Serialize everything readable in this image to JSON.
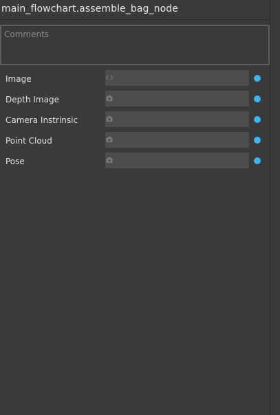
{
  "node": {
    "title": "main_flowchart.assemble_bag_node"
  },
  "comments": {
    "placeholder": "Comments",
    "value": ""
  },
  "ports": [
    {
      "label": "Image",
      "icon": "code-brackets-icon"
    },
    {
      "label": "Depth Image",
      "icon": "camera-icon"
    },
    {
      "label": "Camera Instrinsic",
      "icon": "camera-icon"
    },
    {
      "label": "Point Cloud",
      "icon": "camera-icon"
    },
    {
      "label": "Pose",
      "icon": "camera-icon"
    }
  ],
  "colors": {
    "background": "#3a3a3a",
    "field": "#4d4d4d",
    "port": "#3ab4f2",
    "text": "#e0e0e0"
  }
}
